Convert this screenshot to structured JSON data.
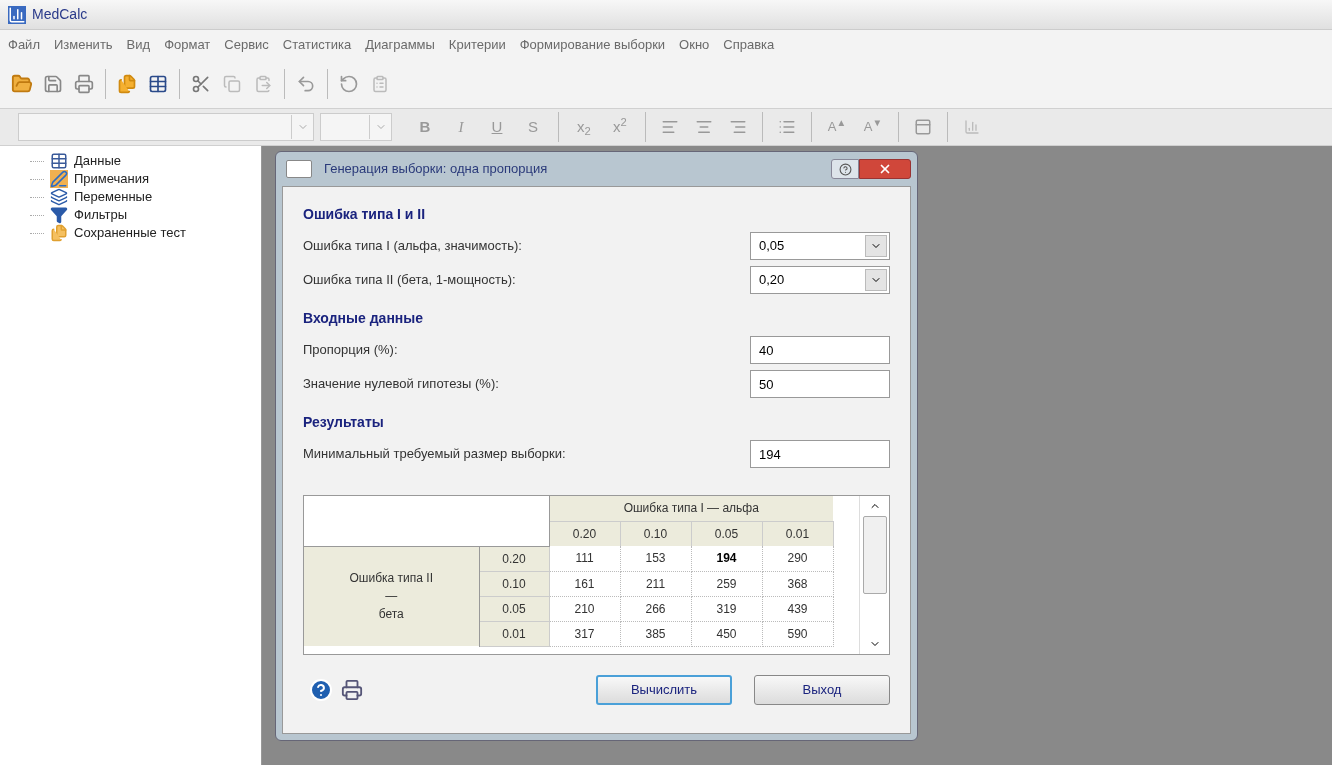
{
  "app": {
    "title": "MedCalc"
  },
  "menu": [
    "Файл",
    "Изменить",
    "Вид",
    "Формат",
    "Сервис",
    "Статистика",
    "Диаграммы",
    "Критерии",
    "Формирование выборки",
    "Окно",
    "Справка"
  ],
  "format_buttons": [
    {
      "kind": "bold",
      "label": "B"
    },
    {
      "kind": "italic",
      "label": "I"
    },
    {
      "kind": "underline",
      "label": "U"
    },
    {
      "kind": "strike",
      "label": "S"
    },
    {
      "kind": "sep"
    },
    {
      "kind": "script",
      "label": "x$_{2}$"
    },
    {
      "kind": "script",
      "label": "x$^{2}$"
    }
  ],
  "font_buttons": [
    {
      "label": "A$^{▲}$"
    },
    {
      "label": "A$^{▼}$"
    }
  ],
  "tree": [
    {
      "kind": "table",
      "label": "Данные"
    },
    {
      "kind": "notes",
      "label": "Примечания"
    },
    {
      "kind": "variables",
      "label": "Переменные"
    },
    {
      "kind": "filter",
      "label": "Фильтры"
    },
    {
      "kind": "saved",
      "label": "Сохраненные тест"
    }
  ],
  "dialog": {
    "title": "Генерация выборки: одна пропорция",
    "sections": [
      {
        "heading": "Ошибка типа I и II",
        "fields": [
          {
            "kind": "combo",
            "label": "Ошибка типа I (альфа, значимость):",
            "value": "0,05"
          },
          {
            "kind": "combo",
            "label": "Ошибка типа II (бета, 1-мощность):",
            "value": "0,20"
          }
        ]
      },
      {
        "heading": "Входные данные",
        "fields": [
          {
            "kind": "input",
            "label": "Пропорция (%):",
            "value": "40"
          },
          {
            "kind": "input",
            "label": "Значение нулевой гипотезы (%):",
            "value": "50"
          }
        ]
      },
      {
        "heading": "Результаты",
        "fields": [
          {
            "kind": "input",
            "label": "Минимальный требуемый размер выборки:",
            "value": "194"
          }
        ]
      }
    ],
    "table": {
      "column_group": "Ошибка типа I — альфа",
      "columns": [
        "0.20",
        "0.10",
        "0.05",
        "0.01"
      ],
      "row_group": [
        "Ошибка типа II",
        "—",
        "бета"
      ],
      "rows": [
        {
          "header": "0.20",
          "cells": [
            {
              "value": "111",
              "selected": false
            },
            {
              "value": "153",
              "selected": false
            },
            {
              "value": "194",
              "selected": true
            },
            {
              "value": "290",
              "selected": false
            }
          ]
        },
        {
          "header": "0.10",
          "cells": [
            {
              "value": "161",
              "selected": false
            },
            {
              "value": "211",
              "selected": false
            },
            {
              "value": "259",
              "selected": false
            },
            {
              "value": "368",
              "selected": false
            }
          ]
        },
        {
          "header": "0.05",
          "cells": [
            {
              "value": "210",
              "selected": false
            },
            {
              "value": "266",
              "selected": false
            },
            {
              "value": "319",
              "selected": false
            },
            {
              "value": "439",
              "selected": false
            }
          ]
        },
        {
          "header": "0.01",
          "cells": [
            {
              "value": "317",
              "selected": false
            },
            {
              "value": "385",
              "selected": false
            },
            {
              "value": "450",
              "selected": false
            },
            {
              "value": "590",
              "selected": false
            }
          ]
        }
      ]
    },
    "buttons": [
      {
        "label": "Вычислить",
        "default": true
      },
      {
        "label": "Выход",
        "default": false
      }
    ]
  }
}
